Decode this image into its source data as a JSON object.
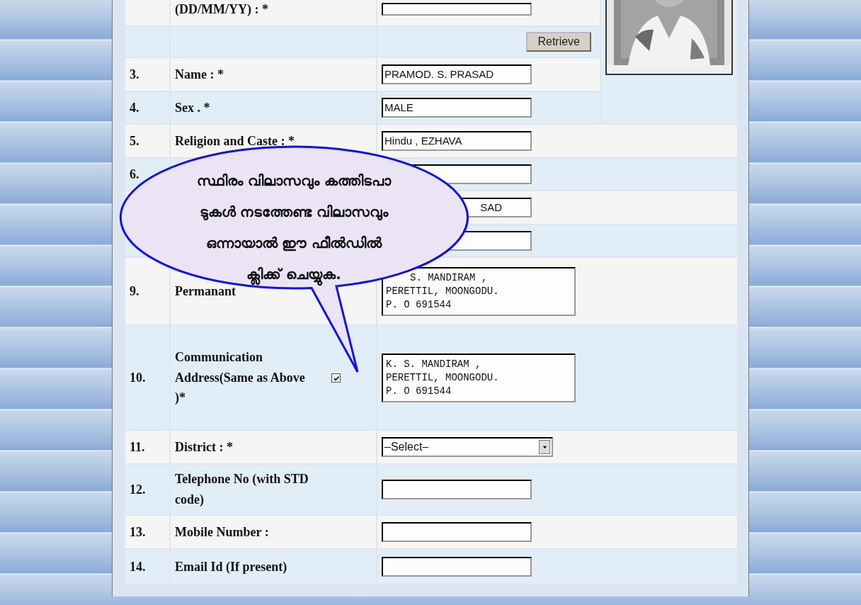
{
  "form": {
    "rows": [
      {
        "kind": "field",
        "number": "",
        "label": "(DD/MM/YY) : *",
        "field": {
          "kind": "text"
        }
      },
      {
        "kind": "retrieve",
        "button": "Retrieve"
      },
      {
        "kind": "field",
        "number": "3.",
        "label": "Name : *",
        "field": {
          "kind": "text",
          "value": "PRAMOD. S. PRASAD"
        }
      },
      {
        "kind": "field",
        "number": "4.",
        "label": "Sex . *",
        "field": {
          "kind": "text",
          "value": "MALE"
        }
      },
      {
        "kind": "field",
        "number": "5.",
        "label": "Religion and Caste : *",
        "field": {
          "kind": "text",
          "value": "Hindu , EZHAVA"
        }
      },
      {
        "kind": "field",
        "number": "6.",
        "label": "",
        "field": {
          "kind": "text"
        }
      },
      {
        "kind": "field",
        "number": "",
        "label": "",
        "field": {
          "kind": "covered",
          "value": "SAD"
        }
      },
      {
        "kind": "field",
        "number": "",
        "label": "",
        "field": {
          "kind": "text"
        }
      },
      {
        "kind": "field",
        "number": "9.",
        "label": "Permanant",
        "field": {
          "kind": "covered-textarea",
          "lines": [
            "S. MANDIRAM ,",
            "PERETTIL, MOONGODU.",
            "P. O 691544"
          ]
        }
      },
      {
        "kind": "field",
        "number": "10.",
        "label": "Communication Address(Same as Above",
        "checkbox": {
          "checked": true
        },
        "label_end": ")*",
        "field": {
          "kind": "textarea",
          "lines": [
            "K. S. MANDIRAM ,",
            "PERETTIL, MOONGODU.",
            "P. O 691544"
          ]
        }
      },
      {
        "kind": "field",
        "number": "11.",
        "label": "District : *",
        "field": {
          "kind": "select",
          "value": "–Select–"
        }
      },
      {
        "kind": "field",
        "number": "12.",
        "label": "Telephone No (with STD code)",
        "field": {
          "kind": "text"
        }
      },
      {
        "kind": "field",
        "number": "13.",
        "label": "Mobile Number :",
        "field": {
          "kind": "text"
        }
      },
      {
        "kind": "field",
        "number": "14.",
        "label": "Email Id (If present)",
        "field": {
          "kind": "text"
        }
      }
    ]
  },
  "callout": {
    "lines": [
      "സ്ഥിരം വിലാസവും കത്തിടപാ",
      "ടുകൾ നടത്തേണ്ട വിലാസവും",
      "ഒന്നായാൽ ഈ ഫീൽഡിൽ",
      "ക്ലിക്ക് ചെയ്യുക."
    ]
  }
}
